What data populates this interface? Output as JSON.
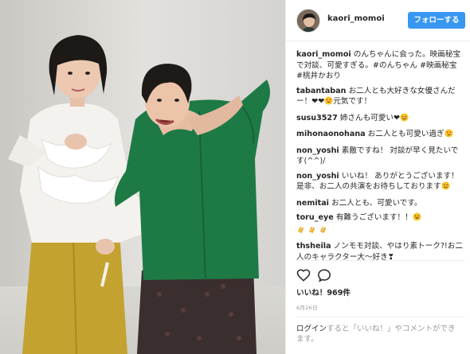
{
  "post": {
    "username": "kaori_momoi",
    "follow_label": "フォローする",
    "likes_text": "いいね！969件",
    "date": "6月26日"
  },
  "icons": {
    "heart": "heart-icon",
    "comment": "comment-icon",
    "heart_emoji": "heart-emoji",
    "heart_eyes_emoji": "heart-eyes-emoji",
    "smile_emoji": "smiling-face-emoji",
    "grin_emoji": "grinning-face-emoji",
    "clap_emoji": "clapping-hands-emoji"
  },
  "comments": [
    {
      "user": "kaori_momoi",
      "text": "のんちゃんに会った。映画秘宝で対談、可愛すぎる。#のんちゃん #映画秘宝 #桃井かおり"
    },
    {
      "user": "tabantaban",
      "text": "お二人とも大好きな女優さんだー！❤❤",
      "suffix": "元気です！"
    },
    {
      "user": "susu3527",
      "text": "姉さんも可愛い❤"
    },
    {
      "user": "mihonaonohana",
      "text": "お二人とも可愛い過ぎ"
    },
    {
      "user": "non_yoshi",
      "text": "素敵ですね！ 対談が早く見たいです(^^)/"
    },
    {
      "user": "non_yoshi",
      "text": "いいね！ ありがとうございます！ 是非、お二人の共演をお待ちしております"
    },
    {
      "user": "nemitai",
      "text": "お二人とも、可愛いです。"
    },
    {
      "user": "toru_eye",
      "text": "有難うございます！！"
    },
    {
      "user": "thsheila",
      "text": "ノンモモ対談、やはり素トーク?!お二人のキャラクター大〜好き❣"
    }
  ],
  "login": {
    "link": "ログイン",
    "text": "すると「いいね！」やコメントができます。"
  },
  "colors": {
    "accent": "#3897f0",
    "green_shirt": "#1e7a45",
    "white_blouse": "#f4f2ee",
    "mustard_pants": "#c4a22f"
  }
}
